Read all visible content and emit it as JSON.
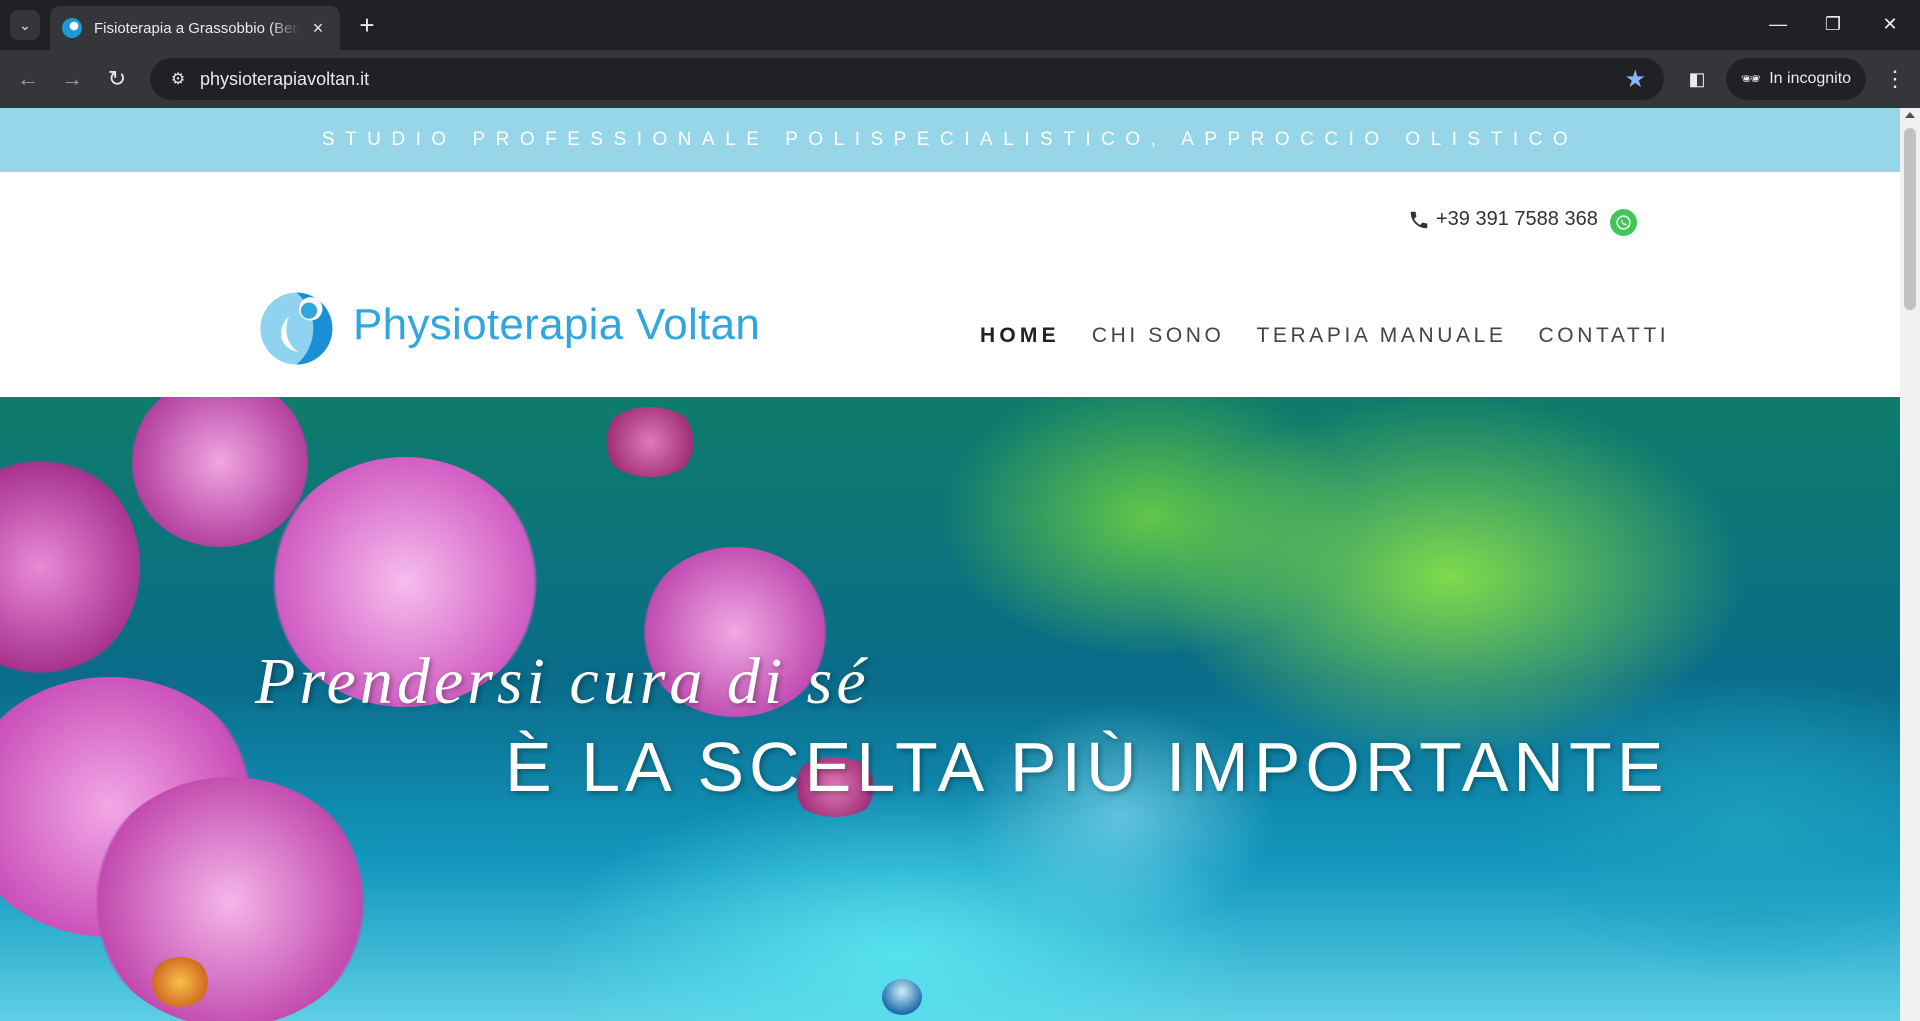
{
  "browser": {
    "tab_title": "Fisioterapia a Grassobbio (Bergamo)",
    "url": "physioterapiavoltan.it",
    "incognito_label": "In incognito"
  },
  "site": {
    "tagline": "STUDIO PROFESSIONALE POLISPECIALISTICO, APPROCCIO OLISTICO",
    "phone": "+39 391 7588 368",
    "logo_text": "Physioterapia Voltan",
    "nav": [
      "HOME",
      "CHI SONO",
      "TERAPIA MANUALE",
      "CONTATTI"
    ],
    "active_nav": "HOME"
  },
  "hero": {
    "line1": "Prendersi cura di sé",
    "line2": "È LA SCELTA PIÙ IMPORTANTE"
  },
  "colors": {
    "topbar": "#97d6e8",
    "brand_blue": "#2fa6dd",
    "whatsapp": "#44c55a"
  },
  "icons": [
    "search-tabs-icon",
    "favicon-icon",
    "close-icon",
    "plus-icon",
    "back-arrow-icon",
    "forward-arrow-icon",
    "reload-icon",
    "site-info-icon",
    "star-icon",
    "side-panel-icon",
    "incognito-icon",
    "kebab-menu-icon",
    "phone-icon",
    "whatsapp-icon"
  ]
}
